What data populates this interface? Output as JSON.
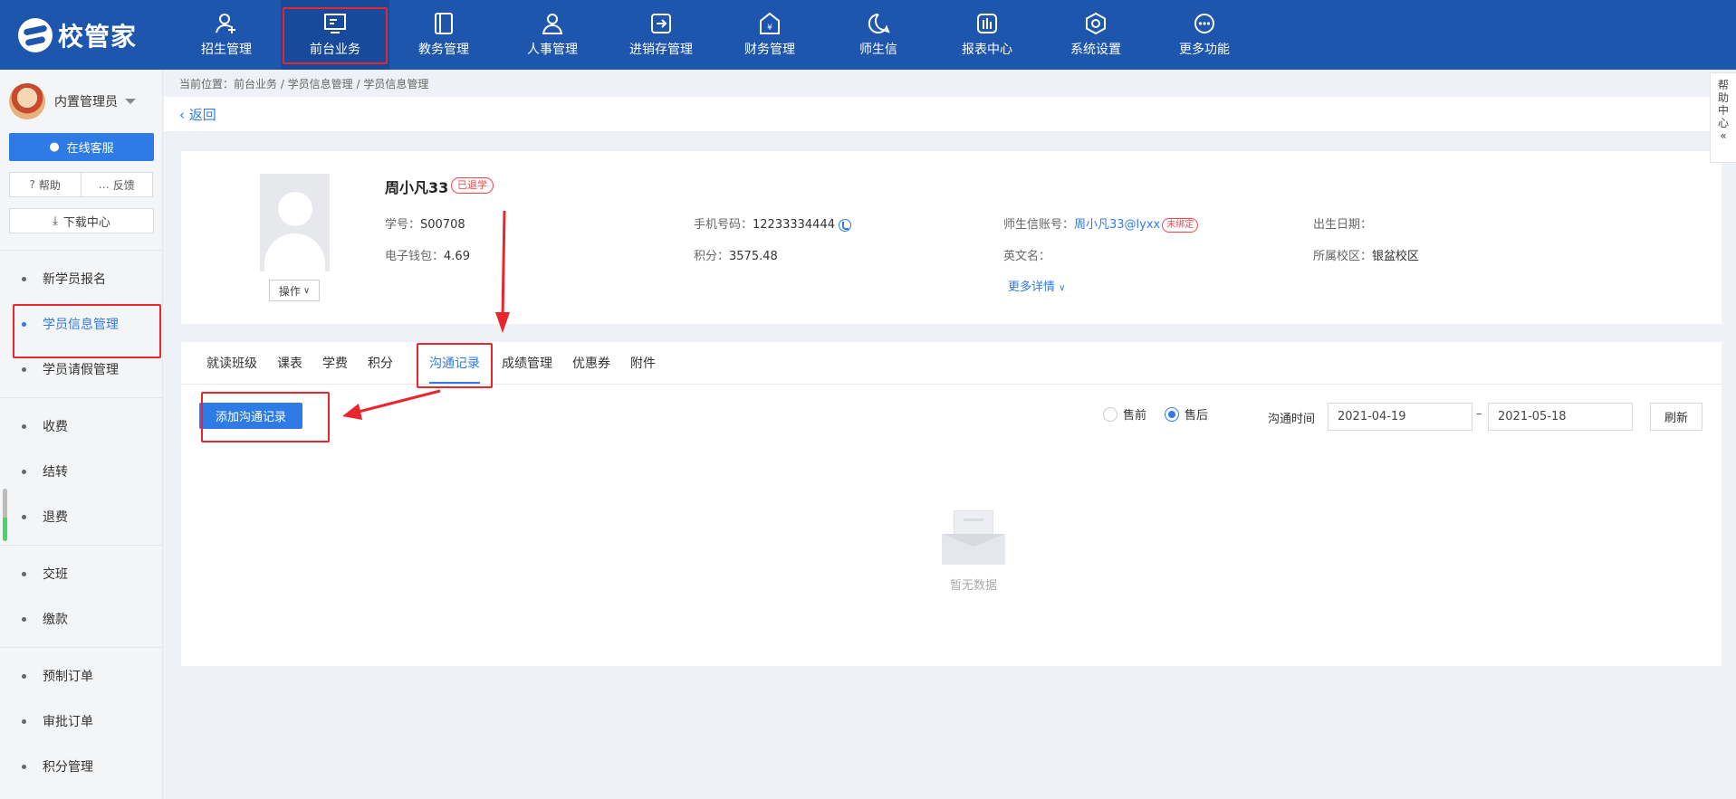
{
  "app": {
    "logo_text": "校管家"
  },
  "nav": {
    "items": [
      {
        "label": "招生管理",
        "icon": "user-plus-icon"
      },
      {
        "label": "前台业务",
        "icon": "front-desk-icon",
        "active": true
      },
      {
        "label": "教务管理",
        "icon": "book-icon"
      },
      {
        "label": "人事管理",
        "icon": "person-icon"
      },
      {
        "label": "进销存管理",
        "icon": "inventory-icon"
      },
      {
        "label": "财务管理",
        "icon": "finance-icon"
      },
      {
        "label": "师生信",
        "icon": "message-icon"
      },
      {
        "label": "报表中心",
        "icon": "report-icon"
      },
      {
        "label": "系统设置",
        "icon": "settings-icon"
      },
      {
        "label": "更多功能",
        "icon": "more-icon"
      }
    ]
  },
  "sidebar": {
    "user_name": "内置管理员",
    "service_label": "在线客服",
    "help_label": "帮助",
    "feedback_label": "反馈",
    "download_label": "下载中心",
    "groups": [
      [
        {
          "label": "新学员报名"
        },
        {
          "label": "学员信息管理",
          "active": true
        },
        {
          "label": "学员请假管理"
        }
      ],
      [
        {
          "label": "收费"
        },
        {
          "label": "结转"
        },
        {
          "label": "退费"
        }
      ],
      [
        {
          "label": "交班"
        },
        {
          "label": "缴款"
        }
      ],
      [
        {
          "label": "预制订单"
        },
        {
          "label": "审批订单"
        },
        {
          "label": "积分管理"
        }
      ]
    ]
  },
  "breadcrumb": "当前位置：前台业务 / 学员信息管理 / 学员信息管理",
  "back_label": "返回",
  "student": {
    "name": "周小凡33",
    "status_tag": "已退学",
    "op_label": "操作",
    "student_no_label": "学号：",
    "student_no": "S00708",
    "phone_label": "手机号码：",
    "phone": "12233334444",
    "account_label": "师生信账号：",
    "account": "周小凡33@lyxx",
    "account_tag": "未绑定",
    "birth_label": "出生日期：",
    "wallet_label": "电子钱包：",
    "wallet": "4.69",
    "points_label": "积分：",
    "points": "3575.48",
    "english_label": "英文名：",
    "campus_label": "所属校区：",
    "campus": "银盆校区",
    "more_label": "更多详情"
  },
  "tabs": [
    {
      "label": "就读班级"
    },
    {
      "label": "课表"
    },
    {
      "label": "学费"
    },
    {
      "label": "积分"
    },
    {
      "label": "沟通记录",
      "active": true
    },
    {
      "label": "成绩管理"
    },
    {
      "label": "优惠券"
    },
    {
      "label": "附件"
    }
  ],
  "comm": {
    "add_label": "添加沟通记录",
    "presale_label": "售前",
    "aftersale_label": "售后",
    "time_label": "沟通时间",
    "start_date": "2021-04-19",
    "date_sep": "–",
    "end_date": "2021-05-18",
    "refresh_label": "刷新",
    "empty_text": "暂无数据"
  },
  "help_center": [
    "帮",
    "助",
    "中",
    "心",
    "«"
  ],
  "colors": {
    "nav_bg": "#1e56ad",
    "accent": "#2f7be5",
    "annotation": "#e8262b"
  }
}
